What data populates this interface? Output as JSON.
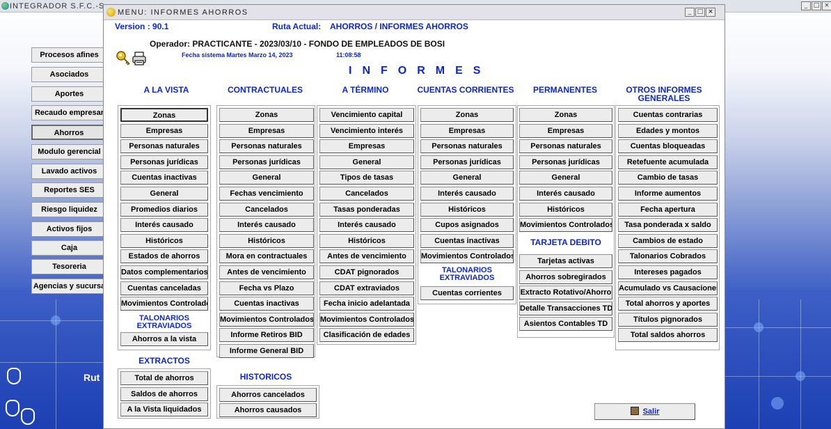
{
  "outer": {
    "title": "INTEGRADOR S.F.C.-S"
  },
  "nav": {
    "items": [
      "Procesos afines",
      "Asociados",
      "Aportes",
      "Recaudo empresar",
      "Ahorros",
      "Modulo gerencial",
      "Lavado activos",
      "Reportes SES",
      "Riesgo liquidez",
      "Activos fijos",
      "Caja",
      "Tesoreria",
      "Agencias y sucursa"
    ],
    "active": "Ahorros"
  },
  "background": {
    "ruta_label": "Rut"
  },
  "dialog": {
    "title": "MENU: INFORMES AHORROS",
    "version": "Version : 90.1",
    "ruta_label": "Ruta Actual:",
    "ruta_value": "AHORROS / INFORMES AHORROS",
    "operador": "Operador: PRACTICANTE - 2023/03/10 - FONDO DE EMPLEADOS DE BOSI",
    "fecha": "Fecha sistema Martes Marzo 14, 2023",
    "hora": "11:08:58",
    "main_title": "INFORMES",
    "exit_label": "Salir",
    "icons": [
      "key-icon",
      "printer-icon",
      "exit-door-icon"
    ]
  },
  "columns": {
    "a_la_vista": {
      "heading": "A LA VISTA",
      "items": [
        "Zonas",
        "Empresas",
        "Personas naturales",
        "Personas jurídicas",
        "Cuentas inactivas",
        "General",
        "Promedios diarios",
        "Interés causado",
        "Históricos",
        "Estados de ahorros",
        "Datos complementarios",
        "Cuentas canceladas",
        "Movimientos Controlados"
      ],
      "sub_heading": "TALONARIOS EXTRAVIADOS",
      "sub_items": [
        "Ahorros a la vista"
      ]
    },
    "contractuales": {
      "heading": "CONTRACTUALES",
      "items": [
        "Zonas",
        "Empresas",
        "Personas naturales",
        "Personas jurídicas",
        "General",
        "Fechas vencimiento",
        "Cancelados",
        "Interés causado",
        "Históricos",
        "Mora en contractuales",
        "Antes de vencimiento",
        "Fecha vs Plazo",
        "Cuentas inactivas",
        "Movimientos Controlados",
        "Informe Retiros BID",
        "Informe General BID"
      ]
    },
    "a_termino": {
      "heading": "A TÉRMINO",
      "items": [
        "Vencimiento capital",
        "Vencimiento  interés",
        "Empresas",
        "General",
        "Tipos de tasas",
        "Cancelados",
        "Tasas ponderadas",
        "Interés causado",
        "Históricos",
        "Antes de vencimiento",
        "CDAT pignorados",
        "CDAT extraviados",
        "Fecha inicio adelantada",
        "Movimientos Controlados",
        "Clasificación de edades"
      ]
    },
    "cuentas_corrientes": {
      "heading": "CUENTAS CORRIENTES",
      "items": [
        "Zonas",
        "Empresas",
        "Personas naturales",
        "Personas jurídicas",
        "General",
        "Interés causado",
        "Históricos",
        "Cupos asignados",
        "Cuentas inactivas",
        "Movimientos Controlados"
      ],
      "sub_heading": "TALONARIOS EXTRAVIADOS",
      "sub_items": [
        "Cuentas corrientes"
      ]
    },
    "permanentes": {
      "heading": "PERMANENTES",
      "items": [
        "Zonas",
        "Empresas",
        "Personas naturales",
        "Personas jurídicas",
        "General",
        "Interés causado",
        "Históricos",
        "Movimientos Controlados"
      ],
      "sub_heading": "TARJETA DEBITO",
      "sub_items": [
        "Tarjetas activas",
        "Ahorros sobregirados",
        "Extracto Rotativo/Ahorro",
        "Detalle Transacciones TD",
        "Asientos Contables TD"
      ]
    },
    "otros": {
      "heading": "OTROS INFORMES GENERALES",
      "items": [
        "Cuentas contrarias",
        "Edades y montos",
        "Cuentas bloqueadas",
        "Retefuente acumulada",
        "Cambio de tasas",
        "Informe aumentos",
        "Fecha apertura",
        "Tasa ponderada x saldo",
        "Cambios de estado",
        "Talonarios Cobrados",
        "Intereses pagados",
        "Acumulado vs Causaciones",
        "Total ahorros y aportes",
        "Títulos pignorados",
        "Total saldos ahorros"
      ]
    }
  },
  "extractos": {
    "heading": "EXTRACTOS",
    "items": [
      "Total de ahorros",
      "Saldos de ahorros",
      "A la Vista liquidados"
    ]
  },
  "historicos": {
    "heading": "HISTORICOS",
    "items": [
      "Ahorros cancelados",
      "Ahorros causados"
    ]
  }
}
